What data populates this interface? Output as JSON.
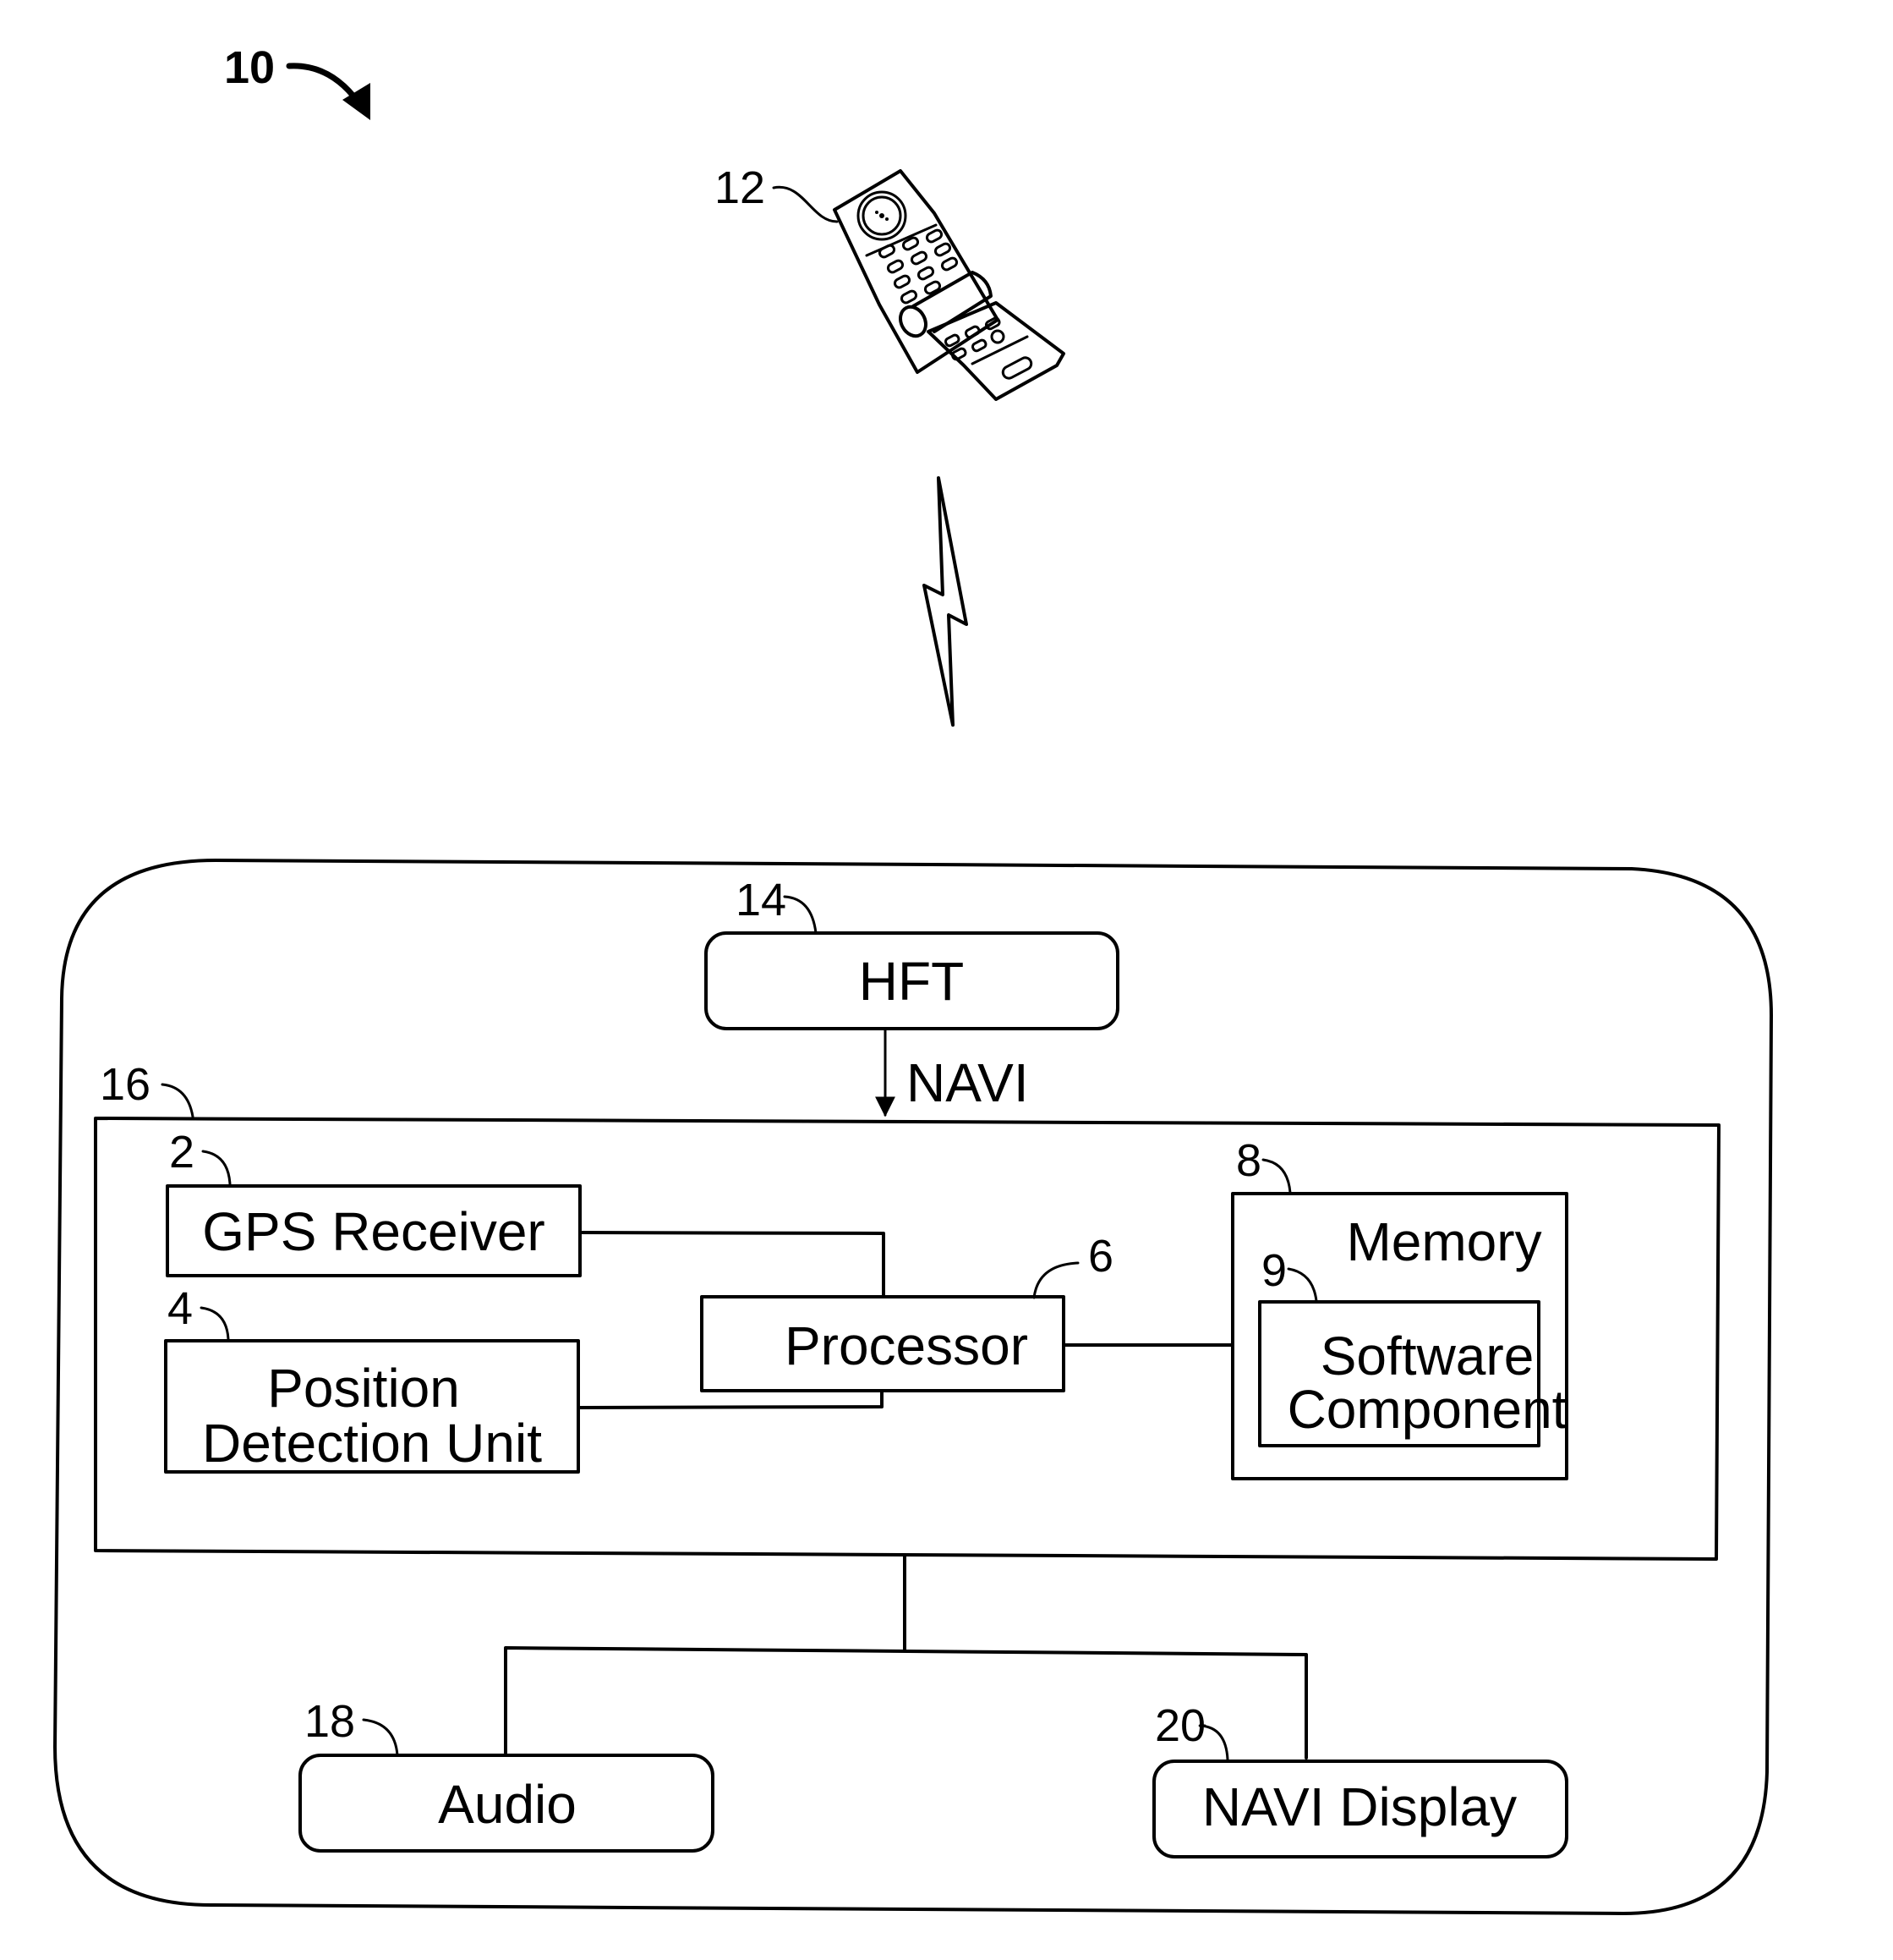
{
  "figure": {
    "reference": "10"
  },
  "phone": {
    "reference": "12",
    "icon": "flip-phone-icon"
  },
  "wireless_link": {
    "icon": "lightning-bolt-icon"
  },
  "vehicle_system": {
    "hft": {
      "reference": "14",
      "label": "HFT"
    },
    "signal_label": "NAVI",
    "navigation_unit": {
      "reference": "16",
      "gps_receiver": {
        "reference": "2",
        "label": "GPS Receiver"
      },
      "position_detection": {
        "reference": "4",
        "label_line1": "Position",
        "label_line2": "Detection Unit"
      },
      "processor": {
        "reference": "6",
        "label": "Processor"
      },
      "memory": {
        "reference": "8",
        "label": "Memory",
        "software_component": {
          "reference": "9",
          "label_line1": "Software",
          "label_line2": "Component"
        }
      }
    },
    "audio": {
      "reference": "18",
      "label": "Audio"
    },
    "navi_display": {
      "reference": "20",
      "label": "NAVI Display"
    }
  },
  "colors": {
    "line": "#000000",
    "background": "#ffffff"
  }
}
